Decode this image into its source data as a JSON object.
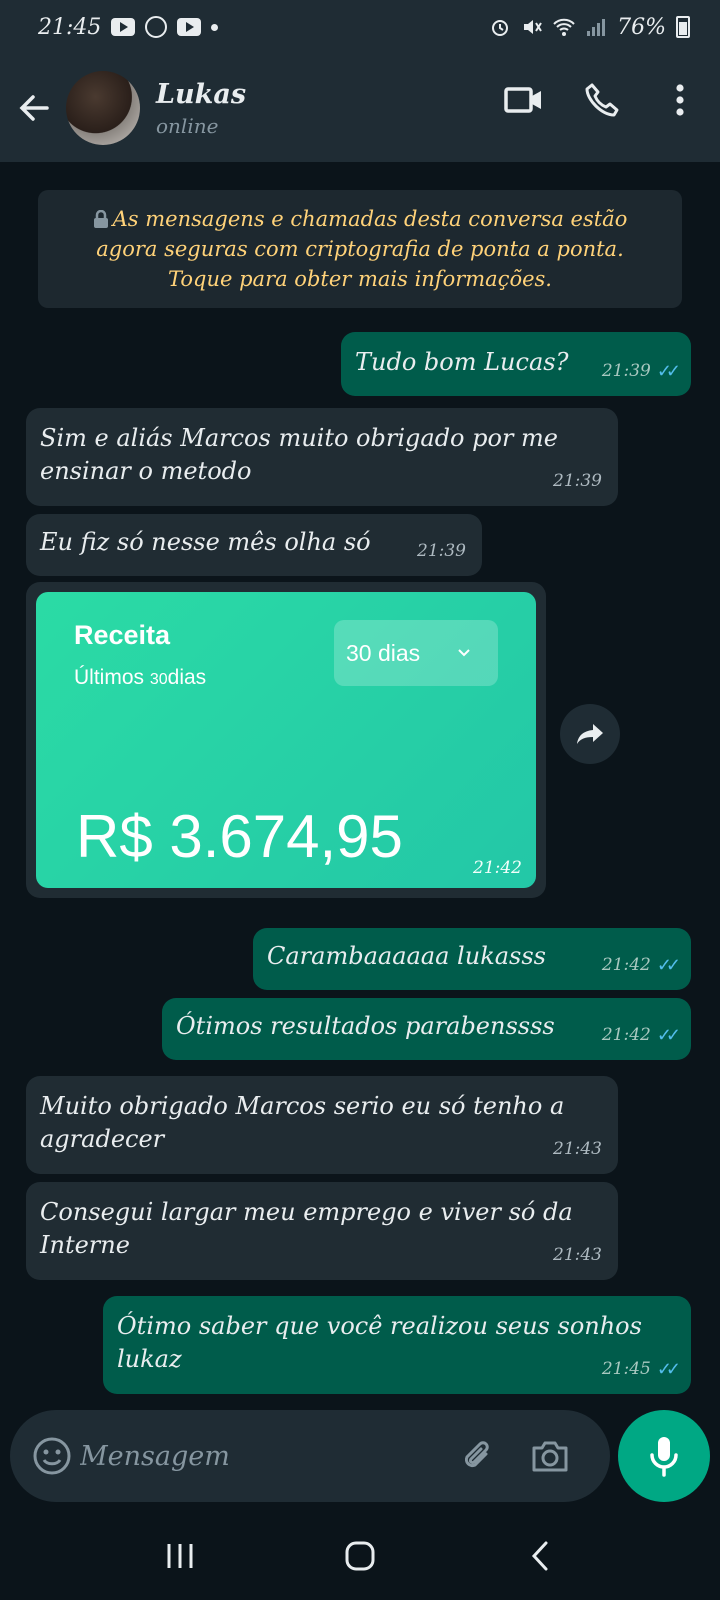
{
  "status_bar": {
    "time": "21:45",
    "battery": "76%"
  },
  "header": {
    "contact_name": "Lukas",
    "contact_status": "online"
  },
  "encryption_notice": {
    "line1": "As mensagens e chamadas desta conversa estão",
    "line2": "agora seguras com criptografia de ponta a ponta.",
    "line3": "Toque para obter mais informações."
  },
  "messages": [
    {
      "direction": "out",
      "text": "Tudo bom Lucas?",
      "time": "21:39"
    },
    {
      "direction": "in",
      "text": "Sim e aliás Marcos muito obrigado por me ensinar o metodo",
      "time": "21:39"
    },
    {
      "direction": "in",
      "text": "Eu fiz só nesse mês olha só",
      "time": "21:39"
    },
    {
      "direction": "out",
      "text": "Carambaaaaaa lukasss",
      "time": "21:42"
    },
    {
      "direction": "out",
      "text": "Ótimos resultados parabenssss",
      "time": "21:42"
    },
    {
      "direction": "in",
      "text": "Muito obrigado Marcos serio eu só tenho a agradecer",
      "time": "21:43"
    },
    {
      "direction": "in",
      "text": "Consegui largar meu emprego e viver só da Interne",
      "time": "21:43"
    },
    {
      "direction": "out",
      "text": "Ótimo saber que você realizou seus sonhos lukaz",
      "time": "21:45"
    }
  ],
  "image_message": {
    "title": "Receita",
    "subtitle_prefix": "Últimos",
    "subtitle_number": "30",
    "subtitle_suffix": "dias",
    "period_select": "30 dias",
    "amount": "R$ 3.674,95",
    "time": "21:42"
  },
  "composer": {
    "placeholder": "Mensagem"
  },
  "colors": {
    "outgoing": "#005c4b",
    "incoming": "#202c33",
    "accent": "#00a884",
    "notice_text": "#ffd279",
    "read_ticks": "#53bdeb"
  },
  "icons": [
    "back-arrow-icon",
    "video-call-icon",
    "phone-icon",
    "more-options-icon",
    "lock-icon",
    "double-check-icon",
    "forward-icon",
    "emoji-icon",
    "attach-icon",
    "camera-icon",
    "mic-icon",
    "recents-icon",
    "home-icon",
    "back-nav-icon"
  ]
}
